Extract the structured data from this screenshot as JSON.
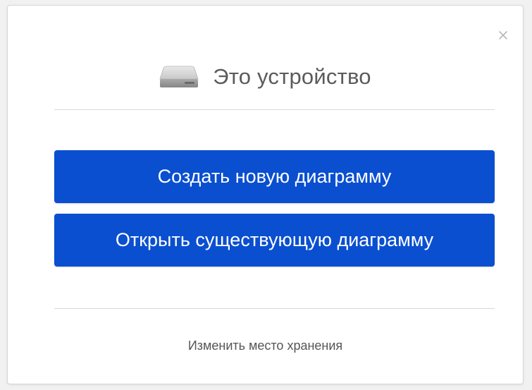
{
  "dialog": {
    "title": "Это устройство",
    "header_icon": "hard-drive-icon",
    "close_icon": "close-icon",
    "close_label": "×",
    "buttons": {
      "create": "Создать новую диаграмму",
      "open": "Открыть существующую диаграмму"
    },
    "change_storage_link": "Изменить место хранения"
  },
  "colors": {
    "button_bg": "#0a4fd0",
    "button_text": "#ffffff",
    "title_text": "#5b5b5b",
    "divider": "#d9d9d9",
    "close_icon": "#b8b8b8"
  }
}
